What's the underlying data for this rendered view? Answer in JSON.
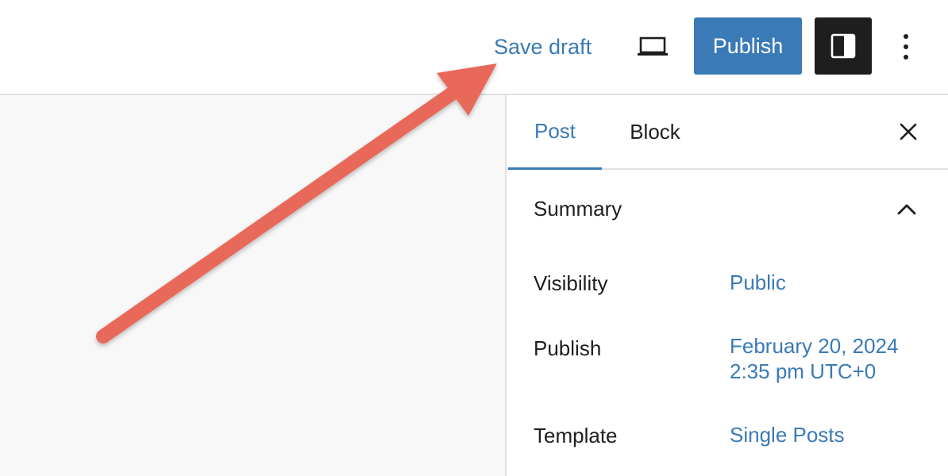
{
  "header": {
    "save_draft_label": "Save draft",
    "preview_icon": "laptop-icon",
    "publish_label": "Publish",
    "settings_icon": "sidebar-panel-icon",
    "more_icon": "vertical-ellipsis-icon"
  },
  "sidebar": {
    "tabs": [
      {
        "label": "Post",
        "active": true
      },
      {
        "label": "Block",
        "active": false
      }
    ],
    "close_icon": "close-icon",
    "panel": {
      "title": "Summary",
      "expanded": true,
      "rows": [
        {
          "label": "Visibility",
          "value": "Public"
        },
        {
          "label": "Publish",
          "value_line1": "February 20, 2024",
          "value_line2": "2:35 pm UTC+0"
        },
        {
          "label": "Template",
          "value": "Single Posts"
        }
      ]
    }
  },
  "annotation": {
    "type": "arrow",
    "points_to": "Save draft",
    "color": "#E8695A"
  },
  "colors": {
    "accent": "#3A7AB6",
    "dark_button": "#1E1E1E",
    "canvas_bg": "#F8F8F8"
  }
}
